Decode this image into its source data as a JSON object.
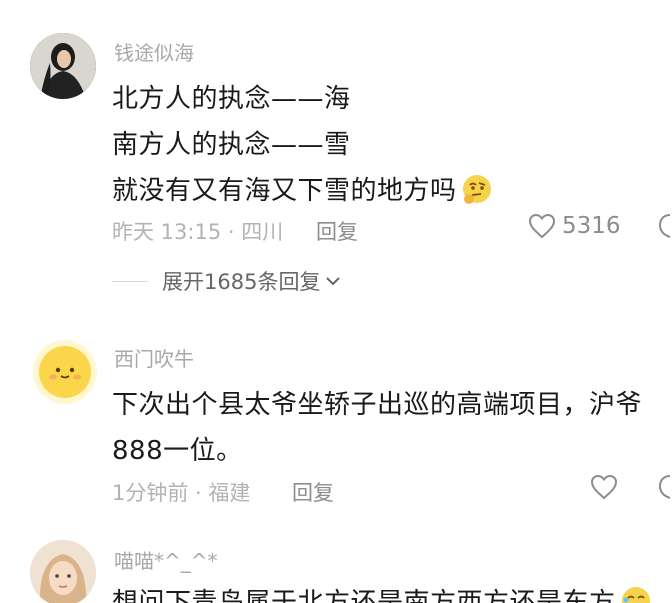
{
  "comments": [
    {
      "username": "钱途似海",
      "lines": [
        "北方人的执念——海",
        "南方人的执念——雪",
        "就没有又有海又下雪的地方吗"
      ],
      "emoji_icon": "thinking-emoji-icon",
      "meta": "昨天 13:15 · 四川",
      "reply_label": "回复",
      "like_count": "5316",
      "expand_label": "展开1685条回复"
    },
    {
      "username": "西门吹牛",
      "lines": [
        "下次出个县太爷坐轿子出巡的高端项目，沪爷",
        "888一位。"
      ],
      "meta": "1分钟前 · 福建",
      "reply_label": "回复",
      "like_count": ""
    },
    {
      "username": "喵喵*^_^*",
      "lines": [
        "想问下青岛属于北方还是南方西方还是东方"
      ],
      "emoji_icon": "laughing-emoji-icon"
    }
  ],
  "colors": {
    "username": "#a9a9a9",
    "text": "#1a1a1a",
    "meta": "#b3b3b3",
    "accent_icon": "#8c8c8c"
  }
}
